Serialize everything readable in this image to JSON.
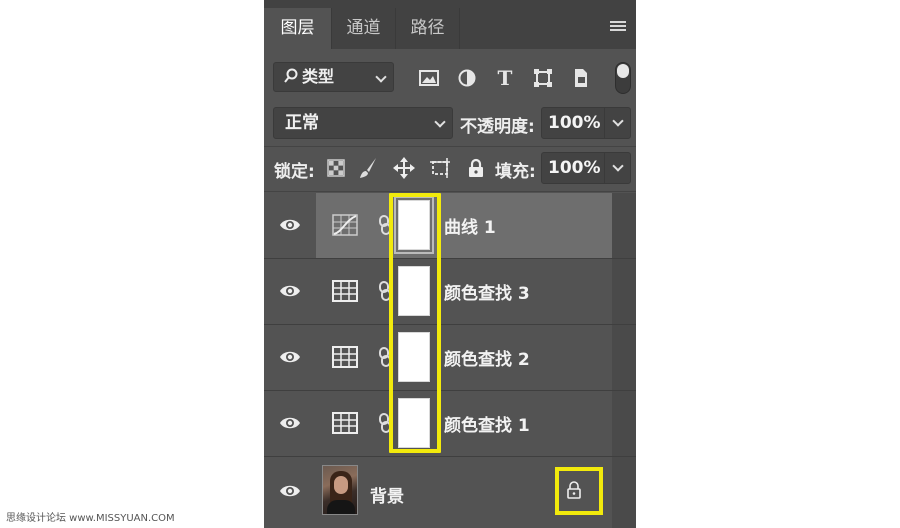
{
  "tabs": [
    {
      "label": "图层",
      "active": true
    },
    {
      "label": "通道",
      "active": false
    },
    {
      "label": "路径",
      "active": false
    }
  ],
  "filter": {
    "label": "类型",
    "icons": [
      "image-filter-icon",
      "adjustment-filter-icon",
      "type-filter-icon",
      "shape-filter-icon",
      "smart-object-filter-icon"
    ]
  },
  "blend": {
    "mode": "正常",
    "opacity_label": "不透明度:",
    "opacity_value": "100%"
  },
  "lock": {
    "label": "锁定:",
    "fill_label": "填充:",
    "fill_value": "100%"
  },
  "layers": [
    {
      "name": "曲线 1",
      "type": "curves",
      "selected": true
    },
    {
      "name": "颜色查找 3",
      "type": "color-lookup",
      "selected": false
    },
    {
      "name": "颜色查找 2",
      "type": "color-lookup",
      "selected": false
    },
    {
      "name": "颜色查找 1",
      "type": "color-lookup",
      "selected": false
    },
    {
      "name": "背景",
      "type": "background",
      "selected": false,
      "locked": true
    }
  ],
  "highlight_color": "#f2ea0c",
  "watermark": "思缘设计论坛 www.MISSYUAN.COM"
}
